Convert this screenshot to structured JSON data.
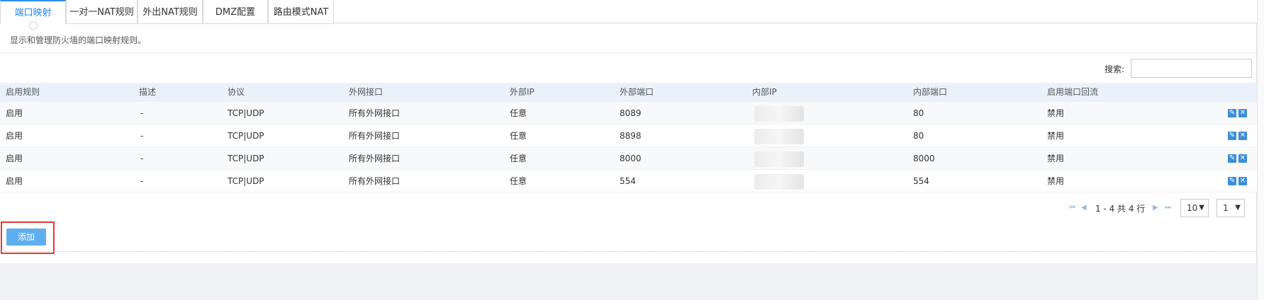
{
  "tabs": [
    {
      "label": "端口映射",
      "active": true
    },
    {
      "label": "一对一NAT规则"
    },
    {
      "label": "外出NAT规则"
    },
    {
      "label": "DMZ配置"
    },
    {
      "label": "路由模式NAT"
    }
  ],
  "description": "显示和管理防火墙的端口映射规则。",
  "search": {
    "label": "搜索:",
    "value": ""
  },
  "table": {
    "headers": [
      "启用规则",
      "描述",
      "协议",
      "外网接口",
      "外部IP",
      "外部端口",
      "内部IP",
      "内部端口",
      "启用端口回流"
    ],
    "rows": [
      {
        "enabled": "启用",
        "desc": "-",
        "protocol": "TCP|UDP",
        "iface": "所有外网接口",
        "ext_ip": "任意",
        "ext_port": "8089",
        "int_ip": "",
        "int_port": "80",
        "reflection": "禁用"
      },
      {
        "enabled": "启用",
        "desc": "-",
        "protocol": "TCP|UDP",
        "iface": "所有外网接口",
        "ext_ip": "任意",
        "ext_port": "8898",
        "int_ip": "",
        "int_port": "80",
        "reflection": "禁用"
      },
      {
        "enabled": "启用",
        "desc": "-",
        "protocol": "TCP|UDP",
        "iface": "所有外网接口",
        "ext_ip": "任意",
        "ext_port": "8000",
        "int_ip": "",
        "int_port": "8000",
        "reflection": "禁用"
      },
      {
        "enabled": "启用",
        "desc": "-",
        "protocol": "TCP|UDP",
        "iface": "所有外网接口",
        "ext_ip": "任意",
        "ext_port": "554",
        "int_ip": "",
        "int_port": "554",
        "reflection": "禁用"
      }
    ],
    "row_actions": {
      "edit_icon": "edit-icon",
      "delete_icon": "delete-icon"
    }
  },
  "pager": {
    "info": "1 - 4 共 4 行",
    "page_size": "10",
    "page": "1"
  },
  "add_button": "添加",
  "colors": {
    "accent": "#2d8fe6",
    "button": "#5eaef0",
    "highlight": "#e23a3a"
  }
}
